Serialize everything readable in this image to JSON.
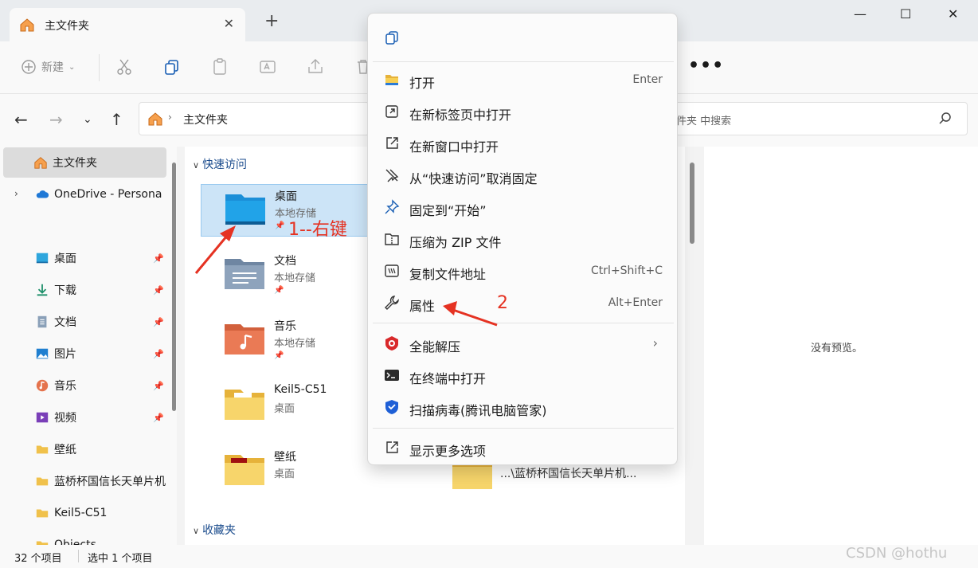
{
  "window": {
    "tab_title": "主文件夹",
    "tab_close": "✕",
    "new_tab": "+",
    "minimize": "—",
    "maximize": "☐",
    "close": "✕"
  },
  "toolbar": {
    "new_label": "新建",
    "more": "•••"
  },
  "address": {
    "path": "主文件夹",
    "search_placeholder": "在 主文件夹 中搜索",
    "search_visible": "件夹 中搜索"
  },
  "sidebar": {
    "items": [
      {
        "label": "主文件夹",
        "icon": "home-icon",
        "selected": true
      },
      {
        "label": "OneDrive - Persona",
        "icon": "cloud-icon"
      },
      {
        "label": "桌面",
        "icon": "desktop-icon",
        "pinned": true
      },
      {
        "label": "下载",
        "icon": "download-icon",
        "pinned": true
      },
      {
        "label": "文档",
        "icon": "document-icon",
        "pinned": true
      },
      {
        "label": "图片",
        "icon": "picture-icon",
        "pinned": true
      },
      {
        "label": "音乐",
        "icon": "music-icon",
        "pinned": true
      },
      {
        "label": "视频",
        "icon": "video-icon",
        "pinned": true
      },
      {
        "label": "壁纸",
        "icon": "folder-icon"
      },
      {
        "label": "蓝桥杯国信长天单片机",
        "icon": "folder-icon"
      },
      {
        "label": "Keil5-C51",
        "icon": "folder-icon"
      },
      {
        "label": "Objects",
        "icon": "folder-icon"
      }
    ]
  },
  "main": {
    "quick_access_label": "快速访问",
    "favorites_label": "收藏夹",
    "items": [
      {
        "name": "桌面",
        "sub": "本地存储",
        "pinned": true,
        "selected": true
      },
      {
        "name": "文档",
        "sub": "本地存储",
        "pinned": true
      },
      {
        "name": "音乐",
        "sub": "本地存储",
        "pinned": true
      },
      {
        "name": "Keil5-C51",
        "sub": "桌面"
      },
      {
        "name": "壁纸",
        "sub": "桌面"
      }
    ],
    "recent_path": "...\\蓝桥杯国信长天单片机..."
  },
  "preview": {
    "empty_text": "没有预览。"
  },
  "status": {
    "count": "32 个项目",
    "selected": "选中 1 个项目"
  },
  "context_menu": {
    "items": [
      {
        "label": "打开",
        "shortcut": "Enter",
        "icon": "folder-open-icon"
      },
      {
        "label": "在新标签页中打开",
        "shortcut": "",
        "icon": "new-tab-icon"
      },
      {
        "label": "在新窗口中打开",
        "shortcut": "",
        "icon": "new-window-icon"
      },
      {
        "label": "从“快速访问”取消固定",
        "shortcut": "",
        "icon": "unpin-icon"
      },
      {
        "label": "固定到“开始”",
        "shortcut": "",
        "icon": "pin-icon"
      },
      {
        "label": "压缩为 ZIP 文件",
        "shortcut": "",
        "icon": "zip-icon"
      },
      {
        "label": "复制文件地址",
        "shortcut": "Ctrl+Shift+C",
        "icon": "copy-path-icon"
      },
      {
        "label": "属性",
        "shortcut": "Alt+Enter",
        "icon": "wrench-icon"
      },
      {
        "label": "全能解压",
        "shortcut": "",
        "icon": "unzip-app-icon",
        "submenu": true
      },
      {
        "label": "在终端中打开",
        "shortcut": "",
        "icon": "terminal-icon"
      },
      {
        "label": "扫描病毒(腾讯电脑管家)",
        "shortcut": "",
        "icon": "shield-icon"
      },
      {
        "label": "显示更多选项",
        "shortcut": "",
        "icon": "more-options-icon"
      }
    ]
  },
  "annotations": {
    "step1": "1--右键",
    "step2": "2"
  },
  "watermark": "CSDN @hothu",
  "colors": {
    "selection": "#cce4f7",
    "annotation": "#e53222",
    "folder": "#f0c14b"
  }
}
